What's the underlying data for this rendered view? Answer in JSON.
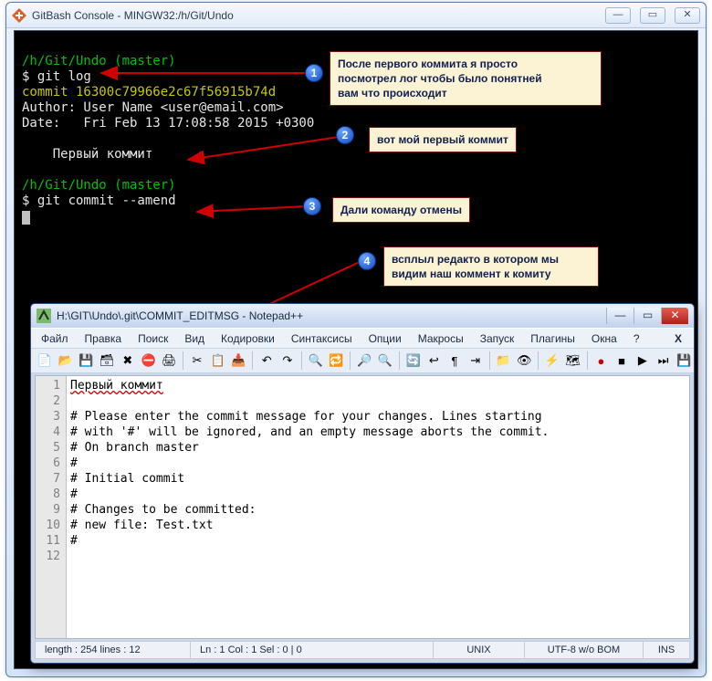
{
  "outer": {
    "title": "GitBash Console - MINGW32:/h/Git/Undo"
  },
  "term": {
    "prompt1": "/h/Git/Undo (master)",
    "cmd1": "$ git log",
    "commit": "commit 16300c79966e2c67f56915b74d",
    "author": "Author: User Name <user@email.com>",
    "date": "Date:   Fri Feb 13 17:08:58 2015 +0300",
    "msg": "    Первый коммит",
    "prompt2": "/h/Git/Undo (master)",
    "cmd2": "$ git commit --amend"
  },
  "callouts": {
    "c1": "После первого коммита я просто\nпосмотрел лог чтобы было понятней\nвам что происходит",
    "c2": "вот мой первый коммит",
    "c3": "Дали команду отмены",
    "c4": "всплыл редакто в котором мы\nвидим наш коммент к комиту"
  },
  "npp": {
    "title": "H:\\GIT\\Undo\\.git\\COMMIT_EDITMSG - Notepad++",
    "menus": [
      "Файл",
      "Правка",
      "Поиск",
      "Вид",
      "Кодировки",
      "Синтаксисы",
      "Опции",
      "Макросы",
      "Запуск",
      "Плагины",
      "Окна",
      "?"
    ],
    "lines": [
      "Первый коммит",
      "",
      "# Please enter the commit message for your changes. Lines starting",
      "# with '#' will be ignored, and an empty message aborts the commit.",
      "# On branch master",
      "#",
      "# Initial commit",
      "#",
      "# Changes to be committed:",
      "#   new file:   Test.txt",
      "#",
      ""
    ],
    "status": {
      "len": "length : 254    lines : 12",
      "pos": "Ln : 1    Col : 1    Sel : 0 | 0",
      "eol": "UNIX",
      "enc": "UTF-8 w/o BOM",
      "mode": "INS"
    }
  }
}
